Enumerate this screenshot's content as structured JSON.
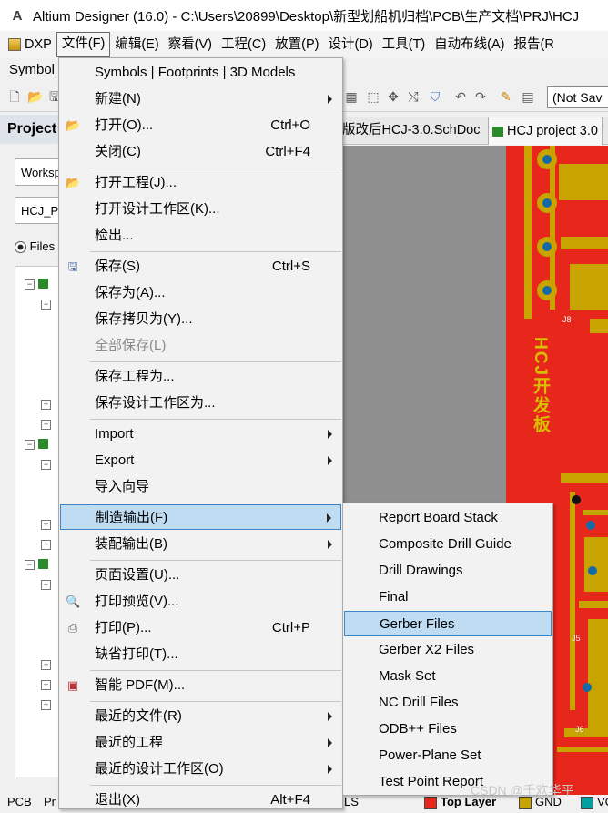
{
  "window": {
    "title": "Altium Designer (16.0) - C:\\Users\\20899\\Desktop\\新型划船机归档\\PCB\\生产文档\\PRJ\\HCJ"
  },
  "menubar": {
    "items": [
      "DXP",
      "文件(F)",
      "编辑(E)",
      "察看(V)",
      "工程(C)",
      "放置(P)",
      "设计(D)",
      "工具(T)",
      "自动布线(A)",
      "报告(R"
    ],
    "active_index": 1
  },
  "row2": {
    "symbols_label": "Symbol"
  },
  "toolbar": {
    "not_saved": "(Not Sav"
  },
  "left_panel": {
    "projects_header": "Project",
    "workspace_combo": "Worksp",
    "project_combo": "HCJ_P",
    "files_radio": "Files",
    "pcb_tab": "PCB",
    "pr_tab": "Pr"
  },
  "doc_tabs": [
    {
      "label": "版改后HCJ-3.0.SchDoc",
      "active": false
    },
    {
      "label": "HCJ project 3.0",
      "active": true
    }
  ],
  "pcb": {
    "silkscreen_text": "HCJ开发板",
    "designators": [
      "J8",
      "J5",
      "J6"
    ]
  },
  "bottom_bar": {
    "ls_label": "LS",
    "layers": [
      {
        "name": "Top Layer",
        "color": "#e8271c"
      },
      {
        "name": "GND",
        "color": "#c8a400"
      },
      {
        "name": "VC",
        "color": "#00a0a0"
      }
    ]
  },
  "file_menu": {
    "items": [
      {
        "label": "Symbols | Footprints | 3D Models",
        "shortcut": "",
        "submenu": false,
        "icon": ""
      },
      {
        "label": "新建(N)",
        "shortcut": "",
        "submenu": true,
        "icon": ""
      },
      {
        "label": "打开(O)...",
        "shortcut": "Ctrl+O",
        "submenu": false,
        "icon": "open-folder-icon"
      },
      {
        "label": "关闭(C)",
        "shortcut": "Ctrl+F4",
        "submenu": false,
        "icon": ""
      },
      {
        "label": "打开工程(J)...",
        "shortcut": "",
        "submenu": false,
        "icon": "open-project-icon"
      },
      {
        "label": "打开设计工作区(K)...",
        "shortcut": "",
        "submenu": false,
        "icon": ""
      },
      {
        "label": "检出...",
        "shortcut": "",
        "submenu": false,
        "icon": ""
      },
      {
        "label": "保存(S)",
        "shortcut": "Ctrl+S",
        "submenu": false,
        "icon": "save-icon"
      },
      {
        "label": "保存为(A)...",
        "shortcut": "",
        "submenu": false,
        "icon": ""
      },
      {
        "label": "保存拷贝为(Y)...",
        "shortcut": "",
        "submenu": false,
        "icon": ""
      },
      {
        "label": "全部保存(L)",
        "shortcut": "",
        "submenu": false,
        "icon": "",
        "disabled": true
      },
      {
        "label": "保存工程为...",
        "shortcut": "",
        "submenu": false,
        "icon": ""
      },
      {
        "label": "保存设计工作区为...",
        "shortcut": "",
        "submenu": false,
        "icon": ""
      },
      {
        "label": "Import",
        "shortcut": "",
        "submenu": true,
        "icon": ""
      },
      {
        "label": "Export",
        "shortcut": "",
        "submenu": true,
        "icon": ""
      },
      {
        "label": "导入向导",
        "shortcut": "",
        "submenu": false,
        "icon": ""
      },
      {
        "label": "制造输出(F)",
        "shortcut": "",
        "submenu": true,
        "icon": "",
        "highlighted": true
      },
      {
        "label": "装配输出(B)",
        "shortcut": "",
        "submenu": true,
        "icon": ""
      },
      {
        "label": "页面设置(U)...",
        "shortcut": "",
        "submenu": false,
        "icon": ""
      },
      {
        "label": "打印预览(V)...",
        "shortcut": "",
        "submenu": false,
        "icon": "print-preview-icon"
      },
      {
        "label": "打印(P)...",
        "shortcut": "Ctrl+P",
        "submenu": false,
        "icon": "printer-icon"
      },
      {
        "label": "缺省打印(T)...",
        "shortcut": "",
        "submenu": false,
        "icon": ""
      },
      {
        "label": "智能 PDF(M)...",
        "shortcut": "",
        "submenu": false,
        "icon": "pdf-icon"
      },
      {
        "label": "最近的文件(R)",
        "shortcut": "",
        "submenu": true,
        "icon": ""
      },
      {
        "label": "最近的工程",
        "shortcut": "",
        "submenu": true,
        "icon": ""
      },
      {
        "label": "最近的设计工作区(O)",
        "shortcut": "",
        "submenu": true,
        "icon": ""
      },
      {
        "label": "退出(X)",
        "shortcut": "Alt+F4",
        "submenu": false,
        "icon": ""
      }
    ]
  },
  "fab_submenu": {
    "items": [
      {
        "label": "Report Board Stack"
      },
      {
        "label": "Composite Drill Guide"
      },
      {
        "label": "Drill Drawings"
      },
      {
        "label": "Final"
      },
      {
        "label": "Gerber Files",
        "highlighted": true
      },
      {
        "label": "Gerber X2 Files"
      },
      {
        "label": "Mask Set"
      },
      {
        "label": "NC Drill Files"
      },
      {
        "label": "ODB++ Files"
      },
      {
        "label": "Power-Plane Set"
      },
      {
        "label": "Test Point Report"
      }
    ]
  },
  "watermark": "CSDN @千欢华平"
}
